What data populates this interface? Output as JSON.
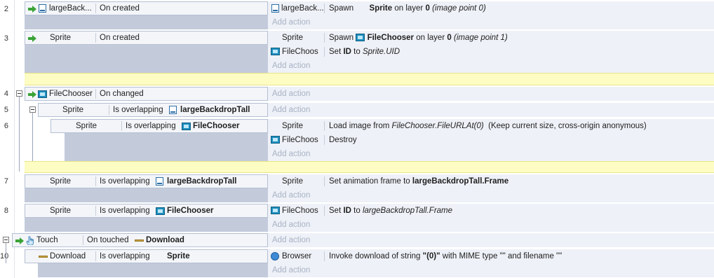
{
  "placeholder": "Add action",
  "rows": [
    {
      "num": "2"
    },
    {
      "num": "3"
    },
    {
      "num": "4"
    },
    {
      "num": "5"
    },
    {
      "num": "6"
    },
    {
      "num": "7"
    },
    {
      "num": "8"
    },
    {
      "num": "10"
    }
  ],
  "events": {
    "e2": {
      "object": "largeBack...",
      "condition": "On created",
      "actions": [
        {
          "object": "largeBack...",
          "verb": "Spawn",
          "obj": "Sprite",
          "mid": "on layer",
          "layer": "0",
          "tail": "(image point 0)"
        }
      ]
    },
    "e3": {
      "object": "Sprite",
      "condition": "On created",
      "actions": [
        {
          "object": "Sprite",
          "verb": "Spawn",
          "obj": "FileChooser",
          "mid": "on layer",
          "layer": "0",
          "tail": "(image point 1)"
        },
        {
          "object": "FileChoos",
          "verb": "Set",
          "key": "ID",
          "to": "to",
          "val": "Sprite.UID"
        }
      ]
    },
    "e4": {
      "object": "FileChooser",
      "condition": "On changed"
    },
    "e5": {
      "object": "Sprite",
      "condition": "Is overlapping",
      "target": "largeBackdropTall"
    },
    "e6": {
      "object": "Sprite",
      "condition": "Is overlapping",
      "target": "FileChooser",
      "actions": [
        {
          "object": "Sprite",
          "pre": "Load image from",
          "expr": "FileChooser.FileURLAt(0)",
          "post": "(Keep current size, cross-origin anonymous)"
        },
        {
          "object": "FileChoos",
          "text": "Destroy"
        }
      ]
    },
    "e7": {
      "object": "Sprite",
      "condition": "Is overlapping",
      "target": "largeBackdropTall",
      "actions": [
        {
          "object": "Sprite",
          "pre": "Set animation frame to",
          "bold": "largeBackdropTall.Frame"
        }
      ]
    },
    "e8": {
      "object": "Sprite",
      "condition": "Is overlapping",
      "target": "FileChooser",
      "actions": [
        {
          "object": "FileChoos",
          "verb": "Set",
          "key": "ID",
          "to": "to",
          "val": "largeBackdropTall.Frame"
        }
      ]
    },
    "e9": {
      "object": "Touch",
      "condition": "On touched",
      "target": "Download"
    },
    "e10": {
      "object": "Download",
      "condition": "Is overlapping",
      "target": "Sprite",
      "actions": [
        {
          "object": "Browser",
          "pre": "Invoke download of string",
          "q1": "\"(0)\"",
          "mid": "with MIME type",
          "q2": "\"\"",
          "and": "and filename",
          "q3": "\"\""
        }
      ]
    }
  },
  "colors": {
    "comment": "#fdfcc3",
    "condition_bg": "#f3f5f9",
    "subevent_fill": "#c3cbdb",
    "action_bg": "#eef1f7"
  }
}
